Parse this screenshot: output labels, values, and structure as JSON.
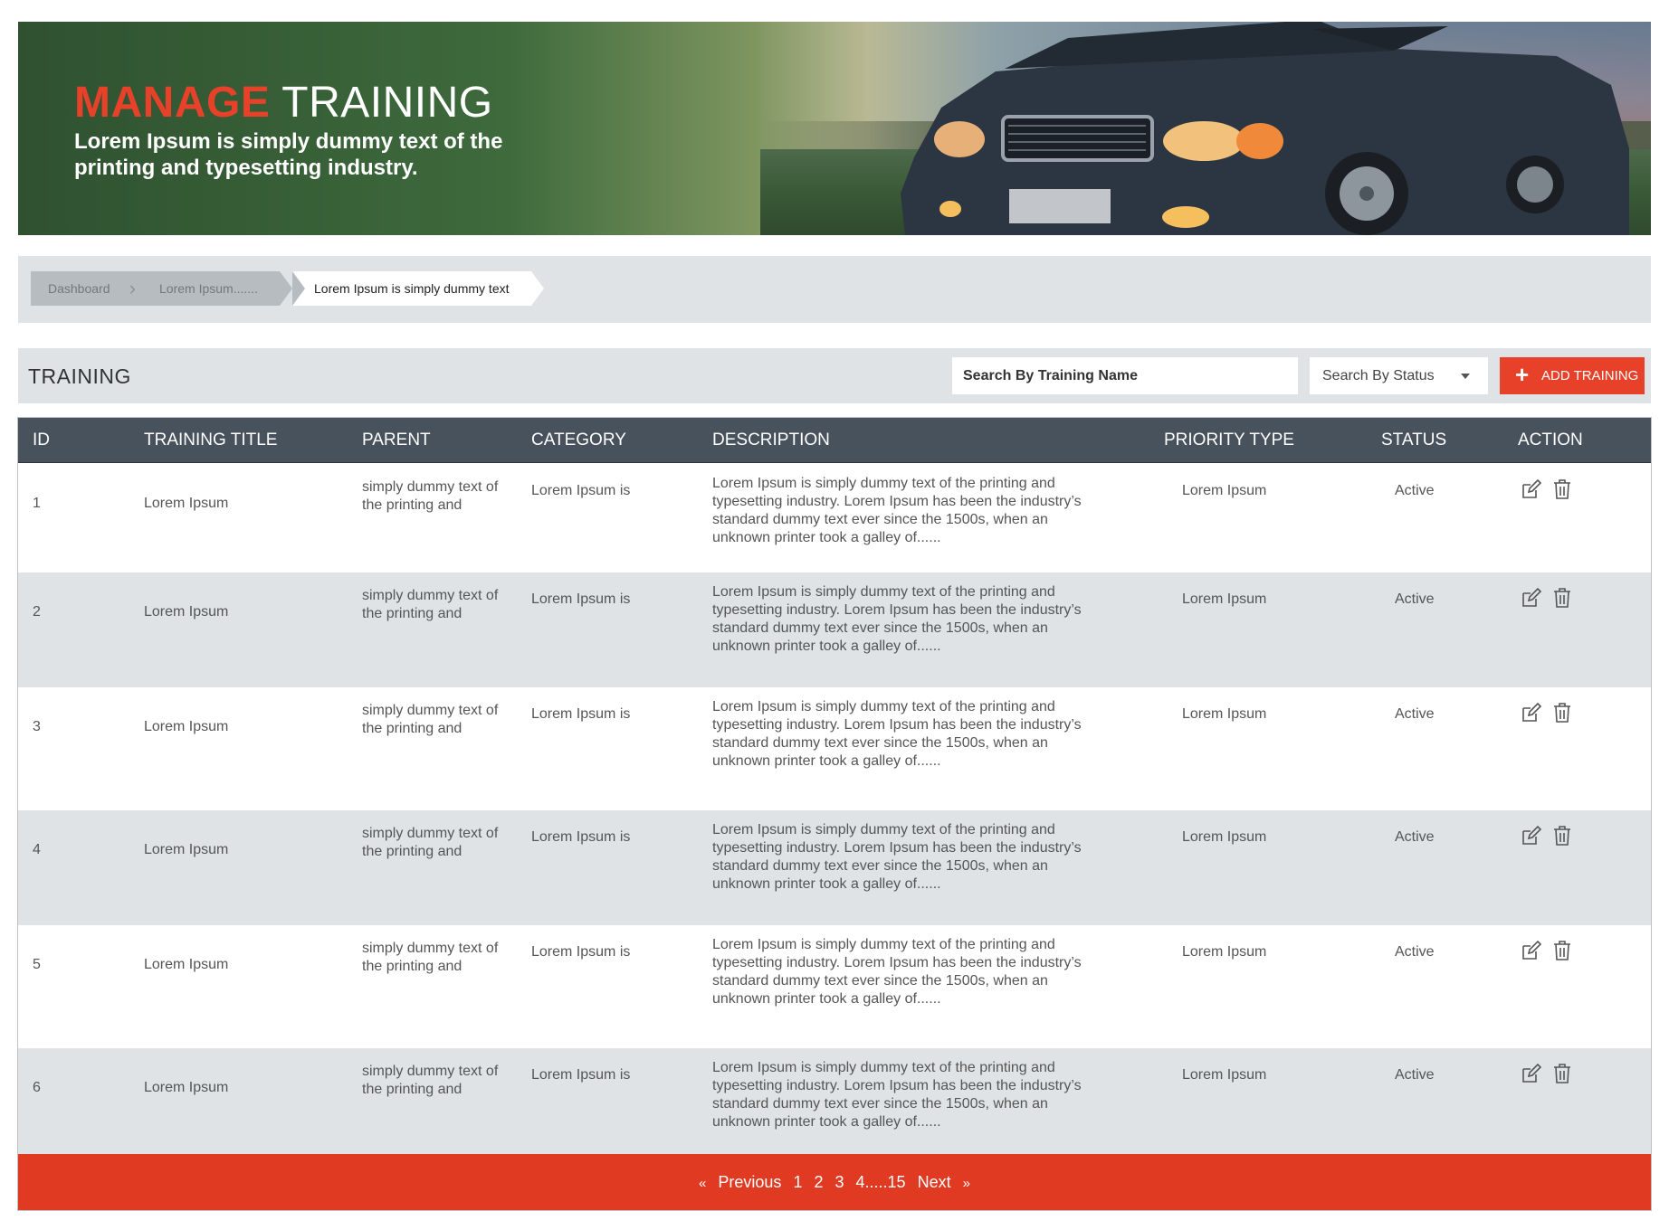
{
  "banner": {
    "title_highlight": "MANAGE",
    "title_rest": "TRAINING",
    "subtitle": "Lorem Ipsum is simply dummy text of the printing and typesetting industry."
  },
  "breadcrumb": [
    "Dashboard",
    "Lorem Ipsum.......",
    "Lorem Ipsum is simply dummy text"
  ],
  "toolbar": {
    "title": "TRAINING",
    "search_placeholder": "Search By Training Name",
    "status_label": "Search By Status",
    "add_label": "ADD TRAINING"
  },
  "table": {
    "headers": {
      "id": "ID",
      "title": "TRAINING TITLE",
      "parent": "PARENT",
      "category": "CATEGORY",
      "description": "DESCRIPTION",
      "priority": "PRIORITY TYPE",
      "status": "STATUS",
      "action": "ACTION"
    },
    "rows": [
      {
        "id": "1",
        "title": "Lorem Ipsum",
        "parent": "simply dummy text of the printing and",
        "category": "Lorem Ipsum is",
        "description": "Lorem Ipsum is simply dummy text of the printing and typesetting industry. Lorem Ipsum has been the industry’s standard dummy text ever since the 1500s, when an unknown printer took a galley of......",
        "priority": "Lorem Ipsum",
        "status": "Active"
      },
      {
        "id": "2",
        "title": "Lorem Ipsum",
        "parent": "simply dummy text of the printing and",
        "category": "Lorem Ipsum is",
        "description": "Lorem Ipsum is simply dummy text of the printing and typesetting industry. Lorem Ipsum has been the industry’s standard dummy text ever since the 1500s, when an unknown printer took a galley of......",
        "priority": "Lorem Ipsum",
        "status": "Active"
      },
      {
        "id": "3",
        "title": "Lorem Ipsum",
        "parent": "simply dummy text of the printing and",
        "category": "Lorem Ipsum is",
        "description": "Lorem Ipsum is simply dummy text of the printing and typesetting industry. Lorem Ipsum has been the industry’s standard dummy text ever since the 1500s, when an unknown printer took a galley of......",
        "priority": "Lorem Ipsum",
        "status": "Active"
      },
      {
        "id": "4",
        "title": "Lorem Ipsum",
        "parent": "simply dummy text of the printing and",
        "category": "Lorem Ipsum is",
        "description": "Lorem Ipsum is simply dummy text of the printing and typesetting industry. Lorem Ipsum has been the industry’s standard dummy text ever since the 1500s, when an unknown printer took a galley of......",
        "priority": "Lorem Ipsum",
        "status": "Active"
      },
      {
        "id": "5",
        "title": "Lorem Ipsum",
        "parent": "simply dummy text of the printing and",
        "category": "Lorem Ipsum is",
        "description": "Lorem Ipsum is simply dummy text of the printing and typesetting industry. Lorem Ipsum has been the industry’s standard dummy text ever since the 1500s, when an unknown printer took a galley of......",
        "priority": "Lorem Ipsum",
        "status": "Active"
      },
      {
        "id": "6",
        "title": "Lorem Ipsum",
        "parent": "simply dummy text of the printing and",
        "category": "Lorem Ipsum is",
        "description": "Lorem Ipsum is simply dummy text of the printing and typesetting industry. Lorem Ipsum has been the industry’s standard dummy text ever since the 1500s, when an unknown printer took a galley of......",
        "priority": "Lorem Ipsum",
        "status": "Active"
      }
    ]
  },
  "pagination": {
    "prev_arrow": "«",
    "prev": "Previous",
    "pages": [
      "1",
      "2",
      "3",
      "4.....15"
    ],
    "next": "Next",
    "next_arrow": "»"
  },
  "icons": {
    "edit": "edit-icon",
    "delete": "trash-icon",
    "add": "plus-icon",
    "dropdown": "caret-down-icon"
  },
  "colors": {
    "accent": "#e8412a",
    "header_bg": "#47525c",
    "row_alt": "#dfe3e6",
    "pager": "#e03a22"
  }
}
